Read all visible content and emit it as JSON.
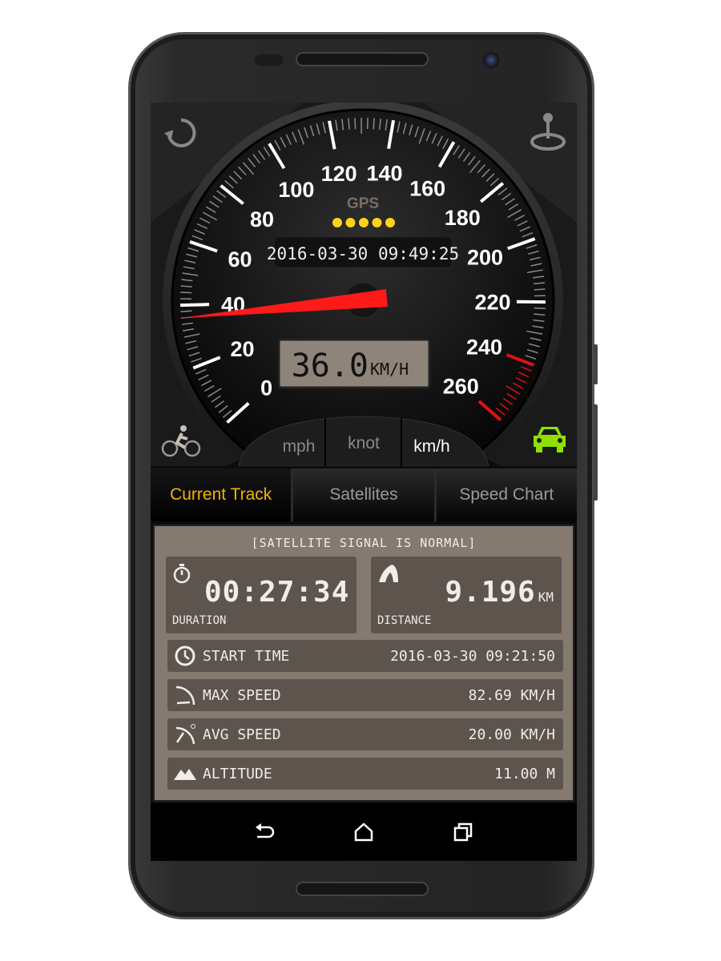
{
  "gauge": {
    "unit_max": 260,
    "major_step": 20,
    "labels": [
      "0",
      "20",
      "40",
      "60",
      "80",
      "100",
      "120",
      "140",
      "160",
      "180",
      "200",
      "220",
      "240",
      "260"
    ],
    "gps_label": "GPS",
    "gps_dots": 5,
    "datetime": "2016-03-30 09:49:25",
    "speed_value": 36.0,
    "speed_text": "36.0",
    "speed_unit": "KM/H",
    "redline_start": 240,
    "colors": {
      "needle": "#ff1a1a",
      "redline": "#e01010",
      "gps_dot": "#ffd21a",
      "car_active": "#8fe000"
    }
  },
  "units": [
    "mph",
    "knot",
    "km/h"
  ],
  "units_selected": "km/h",
  "tabs": [
    {
      "label": "Current Track",
      "active": true
    },
    {
      "label": "Satellites",
      "active": false
    },
    {
      "label": "Speed Chart",
      "active": false
    }
  ],
  "track": {
    "signal_status": "[SATELLITE SIGNAL IS NORMAL]",
    "duration": {
      "value": "00:27:34",
      "label": "DURATION"
    },
    "distance": {
      "value": "9.196",
      "unit": "KM",
      "label": "DISTANCE"
    },
    "rows": [
      {
        "icon": "clock-icon",
        "label": "START TIME",
        "value": "2016-03-30 09:21:50"
      },
      {
        "icon": "max-speed-icon",
        "label": "MAX SPEED",
        "value": "82.69 KM/H"
      },
      {
        "icon": "avg-speed-icon",
        "label": "AVG SPEED",
        "value": "20.00 KM/H"
      },
      {
        "icon": "mountain-icon",
        "label": "ALTITUDE",
        "value": "11.00 M"
      }
    ]
  }
}
